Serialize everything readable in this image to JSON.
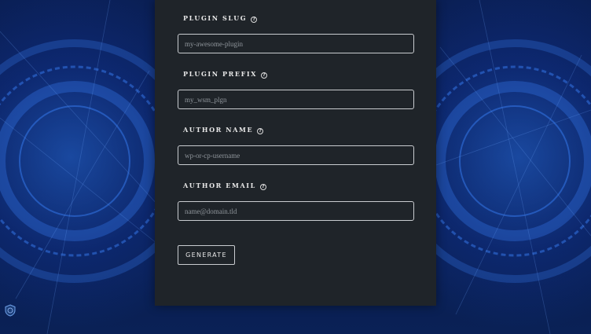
{
  "form": {
    "fields": [
      {
        "label": "Plugin Slug",
        "placeholder": "my-awesome-plugin",
        "help_icon": "question-circle-icon"
      },
      {
        "label": "Plugin Prefix",
        "placeholder": "my_wsm_plgn",
        "help_icon": "question-circle-icon"
      },
      {
        "label": "Author Name",
        "placeholder": "wp-or-cp-username",
        "help_icon": "question-circle-icon"
      },
      {
        "label": "Author Email",
        "placeholder": "name@domain.tld",
        "help_icon": "question-circle-icon"
      }
    ],
    "help_glyph": "?",
    "generate_label": "GENERATE"
  },
  "colors": {
    "panel": "#1f2429",
    "background": "#0a1f55",
    "accent": "#2b6fe0",
    "text": "#e8e8e8",
    "border": "#c9ccd0"
  },
  "badge_icon": "shield-badge-icon"
}
